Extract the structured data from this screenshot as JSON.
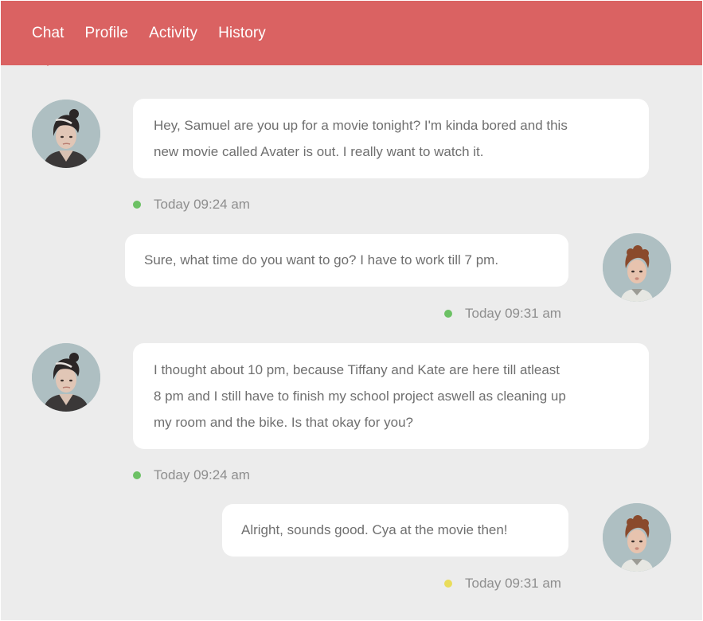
{
  "nav": {
    "tabs": [
      {
        "label": "Chat"
      },
      {
        "label": "Profile"
      },
      {
        "label": "Activity"
      },
      {
        "label": "History"
      }
    ],
    "active": "Chat"
  },
  "colors": {
    "header": "#da6262",
    "background": "#ececec",
    "bubble": "#ffffff",
    "status_online": "#6cc164",
    "status_away": "#e9dc5a"
  },
  "messages": [
    {
      "side": "left",
      "text": "Hey, Samuel are you up for a movie tonight? I'm kinda bored and this new movie called Avater is out. I really want to watch it.",
      "lines": [
        "Hey, Samuel are you up for a movie tonight? I'm kinda bored and this",
        "new movie called Avater is out. I really want to watch it."
      ],
      "time": "Today 09:24 am",
      "status": "online"
    },
    {
      "side": "right",
      "text": "Sure, what time do you want to go? I have to work till 7 pm.",
      "lines": [
        "Sure, what time do you want to go? I have to work till 7 pm."
      ],
      "time": "Today 09:31 am",
      "status": "online"
    },
    {
      "side": "left",
      "text": "I thought about 10 pm, because Tiffany and Kate are here till atleast 8 pm and I still have to finish my school project aswell as cleaning up my room and the bike. Is that okay for you?",
      "lines": [
        "I thought about 10 pm, because Tiffany and Kate are here till atleast",
        "8 pm and I still have to finish my school project aswell as cleaning up",
        "my room and the bike. Is that okay for you?"
      ],
      "time": "Today 09:24 am",
      "status": "online"
    },
    {
      "side": "right",
      "text": "Alright, sounds good. Cya at the movie then!",
      "lines": [
        "Alright, sounds good. Cya at the movie then!"
      ],
      "time": "Today 09:31 am",
      "status": "away"
    }
  ]
}
